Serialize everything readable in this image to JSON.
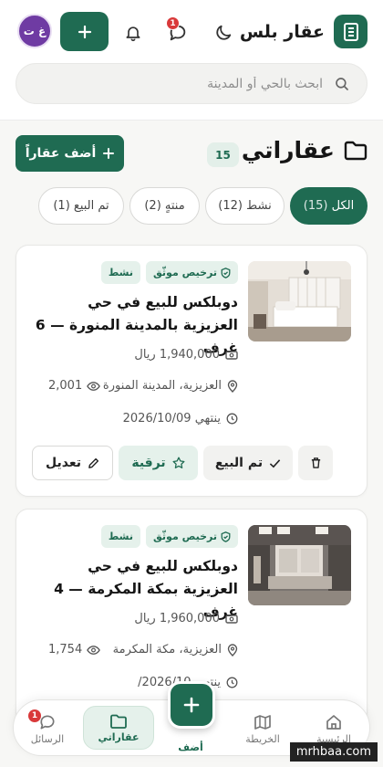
{
  "header": {
    "brand_name": "عقار بلس",
    "notification_count": "1",
    "avatar_initials": "غ ت",
    "search_placeholder": "ابحث بالحي أو المدينة"
  },
  "page": {
    "title": "عقاراتي",
    "count": "15",
    "add_label": "أضف عقاراً"
  },
  "filters": [
    {
      "label": "الكل",
      "count": "(15)",
      "active": true
    },
    {
      "label": "نشط",
      "count": "(12)",
      "active": false
    },
    {
      "label": "منتهٍ",
      "count": "(2)",
      "active": false
    },
    {
      "label": "تم البيع",
      "count": "(1)",
      "active": false
    }
  ],
  "listings": [
    {
      "status": "نشط",
      "license": "ترخيص موثّق",
      "title": "دوبلكس للبيع في حي العزيزية بالمدينة المنورة — 6 غرف",
      "price": "1,940,000 ريال",
      "location": "العزيزية، المدينة المنورة",
      "views": "2,001",
      "expires": "ينتهي 2026/10/09"
    },
    {
      "status": "نشط",
      "license": "ترخيص موثّق",
      "title": "دوبلكس للبيع في حي العزيزية بمكة المكرمة — 4 غرف",
      "price": "1,960,000 ريال",
      "location": "العزيزية، مكة المكرمة",
      "views": "1,754",
      "expires": "ينتهي 2026/10/"
    }
  ],
  "actions": {
    "edit": "تعديل",
    "promote": "ترقية",
    "sold": "تم البيع"
  },
  "bottom_nav": {
    "home": "الرئيسية",
    "map": "الخريطة",
    "add": "أضف",
    "my_properties": "عقاراتي",
    "messages": "الرسائل",
    "messages_count": "1"
  },
  "watermark": "mrhbaa.com",
  "colors": {
    "primary": "#1f6b52",
    "primary_light": "#e5f1eb",
    "badge_red": "#d9393a",
    "avatar": "#6f3ba3"
  }
}
